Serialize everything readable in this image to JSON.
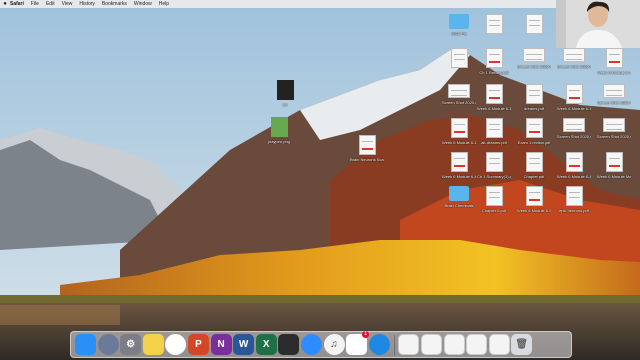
{
  "menubar": {
    "apple_icon": "apple-icon",
    "items": [
      "Safari",
      "File",
      "Edit",
      "View",
      "History",
      "Bookmarks",
      "Window",
      "Help"
    ]
  },
  "desktop_icons": {
    "center": [
      {
        "label": "scr",
        "kind": "dark"
      },
      {
        "label": "playpen.png",
        "kind": "img"
      },
      {
        "label": "Brain Neurons Scanned.pdf",
        "kind": "pdf"
      }
    ],
    "right": [
      {
        "label": "2020 Pic",
        "kind": "folder"
      },
      {
        "label": "",
        "kind": "doc"
      },
      {
        "label": "",
        "kind": "doc"
      },
      {
        "label": "Chapter 1.pdf",
        "kind": "doc"
      },
      {
        "label": "2020 Performance Pictures",
        "kind": "wide"
      },
      {
        "label": "",
        "kind": "doc"
      },
      {
        "label": "Ch 1 Review.pdf",
        "kind": "pdf"
      },
      {
        "label": "Screen Shot 2020-6...16 PM",
        "kind": "wide"
      },
      {
        "label": "Screen Shot 2020-6....39.05 PM",
        "kind": "wide"
      },
      {
        "label": "Week 6 Module 6-1 Rev...1.pdf",
        "kind": "pdf"
      },
      {
        "label": "Screen Shot 2020-6...21.4 PM",
        "kind": "wide"
      },
      {
        "label": "Week 6 Module 6-1 Rev...h.pdf",
        "kind": "pdf"
      },
      {
        "label": "dreams.pdf",
        "kind": "doc"
      },
      {
        "label": "Week 6 Module 6-1 Rev...t.pdf",
        "kind": "pdf"
      },
      {
        "label": "Screen Shot 2020-6...47.6 PM",
        "kind": "wide"
      },
      {
        "label": "Week 6 Module 6-1 Rev...4.pdf",
        "kind": "pdf"
      },
      {
        "label": "alt-dreams.pdf",
        "kind": "doc"
      },
      {
        "label": "Exam 1 review.pdf",
        "kind": "pdf"
      },
      {
        "label": "Screen Shot 2020-6...21.9 PM",
        "kind": "wide"
      },
      {
        "label": "Screen Shot 2020-6...21.8 PM",
        "kind": "wide"
      },
      {
        "label": "Week 6 Module 6-4 Rev...tt.pdf",
        "kind": "pdf"
      },
      {
        "label": "Ch 1 Summary(1).pdf",
        "kind": "doc"
      },
      {
        "label": "Chapter.pdf",
        "kind": "doc"
      },
      {
        "label": "Week 6 Module 6-4 Rev...4.pdf",
        "kind": "pdf"
      },
      {
        "label": "Week 6 Module Mod...kt.pdf",
        "kind": "pdf"
      },
      {
        "label": "Brain Chemicals",
        "kind": "folder"
      },
      {
        "label": "Chapter 6.pdf",
        "kind": "doc"
      },
      {
        "label": "Week 6 Module 6-5 Rev...tt.pdf",
        "kind": "pdf"
      },
      {
        "label": "epic neurons.pdf",
        "kind": "doc"
      }
    ]
  },
  "dock": {
    "apps": [
      {
        "name": "finder-icon",
        "glyph": "",
        "color": "#2a8ff7"
      },
      {
        "name": "launchpad-icon",
        "glyph": "",
        "color": "#6b7a99"
      },
      {
        "name": "system-preferences-icon",
        "glyph": "⚙",
        "color": "#7d7d85"
      },
      {
        "name": "stickies-icon",
        "glyph": "",
        "color": "#f3d24a"
      },
      {
        "name": "chrome-icon",
        "glyph": "",
        "color": "#ffffff"
      },
      {
        "name": "powerpoint-icon",
        "glyph": "P",
        "color": "#d24726"
      },
      {
        "name": "onenote-icon",
        "glyph": "N",
        "color": "#7b2f9e"
      },
      {
        "name": "word-icon",
        "glyph": "W",
        "color": "#2b579a"
      },
      {
        "name": "excel-icon",
        "glyph": "X",
        "color": "#1e7145"
      },
      {
        "name": "camera-icon",
        "glyph": "",
        "color": "#2c2c2c"
      },
      {
        "name": "zoom-icon",
        "glyph": "",
        "color": "#2d8cff"
      },
      {
        "name": "itunes-icon",
        "glyph": "♫",
        "color": "#f3f3f3"
      },
      {
        "name": "photos-icon",
        "glyph": "",
        "color": "#ffffff",
        "badge": "1"
      },
      {
        "name": "safari-icon",
        "glyph": "",
        "color": "#1e88e5"
      }
    ],
    "stacks": [
      {
        "name": "document-stack-1-icon"
      },
      {
        "name": "document-stack-2-icon"
      },
      {
        "name": "document-stack-3-icon"
      },
      {
        "name": "document-stack-4-icon"
      },
      {
        "name": "document-stack-5-icon"
      }
    ],
    "trash_icon": "trash-icon"
  }
}
